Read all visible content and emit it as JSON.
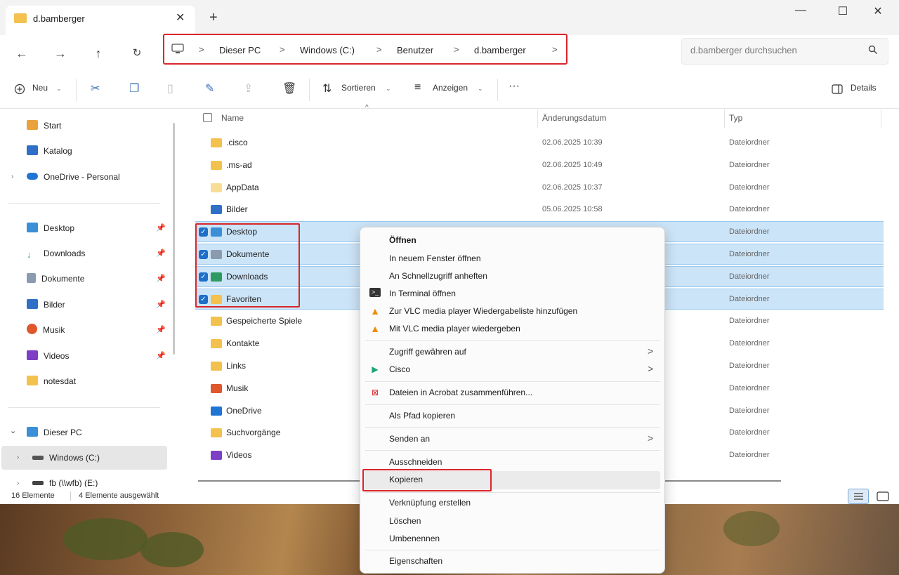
{
  "window": {
    "tab_title": "d.bamberger",
    "tab_close": "✕",
    "new_tab": "+",
    "minimize": "—",
    "maximize": "☐",
    "close": "✕"
  },
  "navigation": {
    "breadcrumbs": [
      "Dieser PC",
      "Windows (C:)",
      "Benutzer",
      "d.bamberger"
    ],
    "separator": ">",
    "search_placeholder": "d.bamberger durchsuchen"
  },
  "toolbar": {
    "new_label": "Neu",
    "sort_label": "Sortieren",
    "view_label": "Anzeigen",
    "more_label": "···",
    "details_label": "Details"
  },
  "sidebar": {
    "top": [
      {
        "label": "Start",
        "color": "#e8a33d"
      },
      {
        "label": "Katalog",
        "color": "#2f6fc6"
      },
      {
        "label": "OneDrive - Personal",
        "color": "#1f74d4"
      }
    ],
    "pinned": [
      {
        "label": "Desktop",
        "color": "#3a8fd6"
      },
      {
        "label": "Downloads",
        "color": "#2d9a62"
      },
      {
        "label": "Dokumente",
        "color": "#8a9bb0"
      },
      {
        "label": "Bilder",
        "color": "#2f6fc6"
      },
      {
        "label": "Musik",
        "color": "#e0562d"
      },
      {
        "label": "Videos",
        "color": "#7d3fc4"
      }
    ],
    "unpinned": [
      {
        "label": "notesdat",
        "color": "#f2c14e"
      }
    ],
    "tree": [
      {
        "label": "Dieser PC",
        "color": "#3a8fd6"
      },
      {
        "label": "Windows (C:)",
        "color": "#555555"
      },
      {
        "label": "fb (\\\\wfb) (E:)",
        "color": "#444444"
      }
    ]
  },
  "columns": {
    "name": "Name",
    "date": "Änderungsdatum",
    "type": "Typ"
  },
  "files": [
    {
      "name": ".cisco",
      "date": "02.06.2025 10:39",
      "type": "Dateiordner",
      "color": "#f2c14e"
    },
    {
      "name": ".ms-ad",
      "date": "02.06.2025 10:49",
      "type": "Dateiordner",
      "color": "#f2c14e"
    },
    {
      "name": "AppData",
      "date": "02.06.2025 10:37",
      "type": "Dateiordner",
      "color": "#f7dd95"
    },
    {
      "name": "Bilder",
      "date": "05.06.2025 10:58",
      "type": "Dateiordner",
      "color": "#2f6fc6"
    },
    {
      "name": "Desktop",
      "date": "",
      "type": "Dateiordner",
      "color": "#3a8fd6"
    },
    {
      "name": "Dokumente",
      "date": "",
      "type": "Dateiordner",
      "color": "#8a9bb0"
    },
    {
      "name": "Downloads",
      "date": "",
      "type": "Dateiordner",
      "color": "#2d9a62"
    },
    {
      "name": "Favoriten",
      "date": "",
      "type": "Dateiordner",
      "color": "#f2c14e"
    },
    {
      "name": "Gespeicherte Spiele",
      "date": "",
      "type": "Dateiordner",
      "color": "#f2c14e"
    },
    {
      "name": "Kontakte",
      "date": "",
      "type": "Dateiordner",
      "color": "#f2c14e"
    },
    {
      "name": "Links",
      "date": "",
      "type": "Dateiordner",
      "color": "#f2c14e"
    },
    {
      "name": "Musik",
      "date": "",
      "type": "Dateiordner",
      "color": "#e0562d"
    },
    {
      "name": "OneDrive",
      "date": "",
      "type": "Dateiordner",
      "color": "#1f74d4"
    },
    {
      "name": "Suchvorgänge",
      "date": "",
      "type": "Dateiordner",
      "color": "#f2c14e"
    },
    {
      "name": "Videos",
      "date": "",
      "type": "Dateiordner",
      "color": "#7d3fc4"
    }
  ],
  "status": {
    "count": "16 Elemente",
    "selected": "4 Elemente ausgewählt"
  },
  "context_menu": {
    "open": "Öffnen",
    "open_new_window": "In neuem Fenster öffnen",
    "pin_quick": "An Schnellzugriff anheften",
    "open_terminal": "In Terminal öffnen",
    "vlc_add": "Zur VLC media player Wiedergabeliste hinzufügen",
    "vlc_play": "Mit VLC media player wiedergeben",
    "grant_access": "Zugriff gewähren auf",
    "cisco": "Cisco",
    "acrobat": "Dateien in Acrobat zusammenführen...",
    "copy_path": "Als Pfad kopieren",
    "send_to": "Senden an",
    "cut": "Ausschneiden",
    "copy": "Kopieren",
    "shortcut": "Verknüpfung erstellen",
    "delete": "Löschen",
    "rename": "Umbenennen",
    "properties": "Eigenschaften",
    "submenu_arrow": ">"
  }
}
